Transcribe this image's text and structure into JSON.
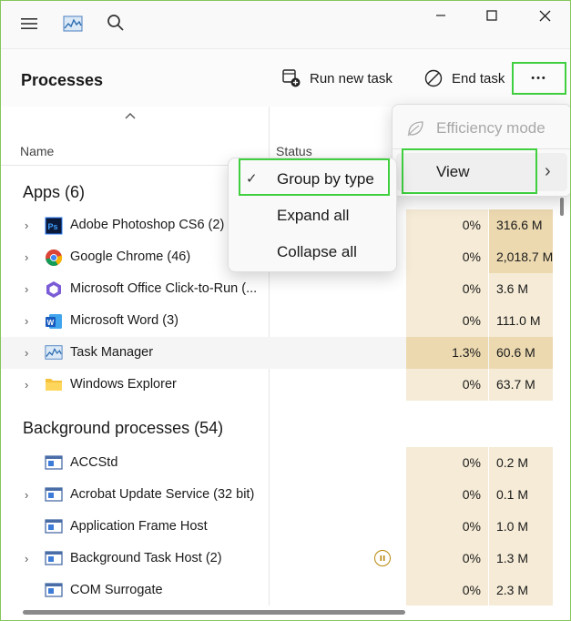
{
  "toolbar": {
    "title": "Processes",
    "run_new_task": "Run new task",
    "end_task": "End task",
    "more": "•••"
  },
  "columns": {
    "name": "Name",
    "status": "Status"
  },
  "groups": {
    "apps": "Apps (6)",
    "background": "Background processes (54)"
  },
  "apps": [
    {
      "name": "Adobe Photoshop CS6 (2)",
      "cpu": "0%",
      "mem": "316.6 M",
      "icon": "photoshop-icon"
    },
    {
      "name": "Google Chrome (46)",
      "cpu": "0%",
      "mem": "2,018.7 M",
      "icon": "chrome-icon"
    },
    {
      "name": "Microsoft Office Click-to-Run (...",
      "cpu": "0%",
      "mem": "3.6 M",
      "icon": "office-icon"
    },
    {
      "name": "Microsoft Word (3)",
      "cpu": "0%",
      "mem": "111.0 M",
      "icon": "word-icon"
    },
    {
      "name": "Task Manager",
      "cpu": "1.3%",
      "mem": "60.6 M",
      "icon": "task-manager-icon"
    },
    {
      "name": "Windows Explorer",
      "cpu": "0%",
      "mem": "63.7 M",
      "icon": "folder-icon"
    }
  ],
  "background": [
    {
      "name": "ACCStd",
      "cpu": "0%",
      "mem": "0.2 M",
      "icon": "app-window-icon"
    },
    {
      "name": "Acrobat Update Service (32 bit)",
      "cpu": "0%",
      "mem": "0.1 M",
      "icon": "app-window-icon"
    },
    {
      "name": "Application Frame Host",
      "cpu": "0%",
      "mem": "1.0 M",
      "icon": "app-window-icon"
    },
    {
      "name": "Background Task Host (2)",
      "cpu": "0%",
      "mem": "1.3 M",
      "icon": "app-window-icon"
    },
    {
      "name": "COM Surrogate",
      "cpu": "0%",
      "mem": "2.3 M",
      "icon": "app-window-icon"
    }
  ],
  "more_menu": {
    "efficiency_mode": "Efficiency mode",
    "view": "View"
  },
  "view_submenu": {
    "group_by_type": "Group by type",
    "expand_all": "Expand all",
    "collapse_all": "Collapse all"
  },
  "icons": {
    "expander": "›",
    "check": "✓",
    "submenu_chevron": "›"
  },
  "colors": {
    "cpu_heat_light": "#f5ebd6",
    "cpu_heat_medium": "#ecd9b0",
    "mem_heat_light": "#f5ebd6",
    "mem_heat_medium": "#ecd9b0",
    "highlight": "#3fcf3f"
  }
}
